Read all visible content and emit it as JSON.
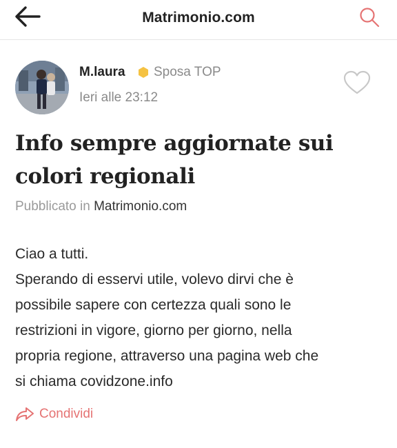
{
  "header": {
    "title": "Matrimonio.com",
    "back_icon": "back-arrow-icon",
    "search_icon": "search-icon"
  },
  "post": {
    "author": {
      "name": "M.laura",
      "badge": "Sposa TOP",
      "badge_icon": "hexagon-icon",
      "time": "Ieri alle 23:12"
    },
    "like_icon": "heart-icon",
    "title": "Info sempre aggiornate sui colori regionali",
    "published_prefix": "Pubblicato in",
    "published_in": "Matrimonio.com",
    "body_lines": [
      "Ciao a tutti.",
      "Sperando di esservi utile, volevo dirvi che è",
      "possibile sapere con certezza quali sono le",
      "restrizioni in vigore, giorno per giorno, nella",
      "propria regione, attraverso una pagina web che",
      "si chiama covidzone.info"
    ],
    "share_label": "Condividi",
    "share_icon": "share-arrow-icon"
  },
  "colors": {
    "accent": "#e57373",
    "badge": "#f5c242",
    "muted_text": "#8a8a8a",
    "icon_gray": "#c8c8c8"
  }
}
